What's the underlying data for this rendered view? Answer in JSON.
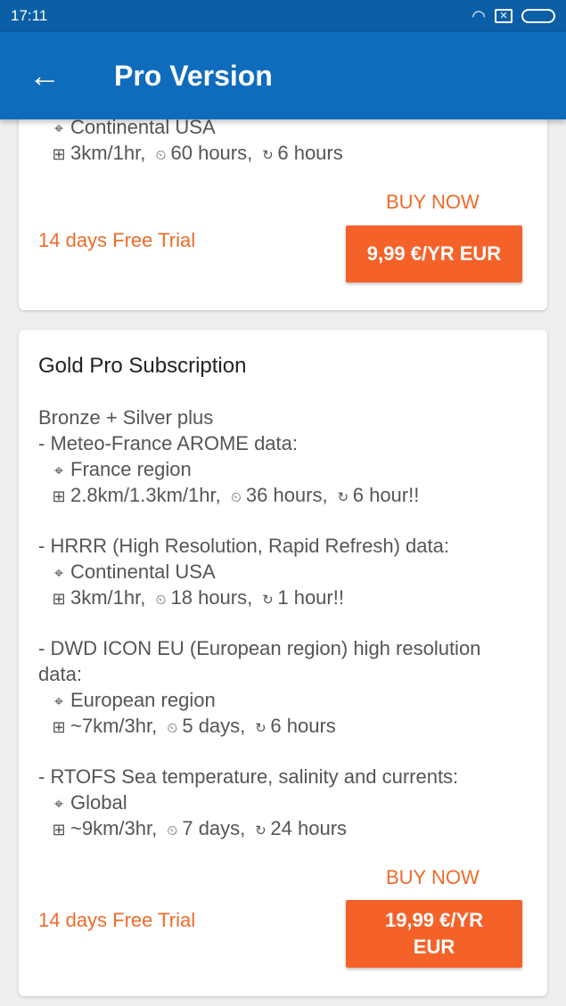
{
  "status_bar": {
    "time": "17:11",
    "icons": [
      "wifi-icon",
      "sim-icon",
      "battery-icon"
    ]
  },
  "app_bar": {
    "back_icon": "arrow-left-icon",
    "title": "Pro Version"
  },
  "card_silver": {
    "region_line": "Continental USA",
    "res_line": {
      "res": "3km/1hr,",
      "range": "60 hours,",
      "update": "6 hours"
    },
    "buy_now": "BUY NOW",
    "trial": "14 days Free Trial",
    "price": "9,99 €/YR EUR"
  },
  "card_gold": {
    "title": "Gold Pro Subscription",
    "intro": "Bronze + Silver plus",
    "sections": [
      {
        "heading": "- Meteo-France AROME data:",
        "region": "France region",
        "res": "2.8km/1.3km/1hr,",
        "range": "36 hours,",
        "update": "6 hour!!"
      },
      {
        "heading": "- HRRR (High Resolution, Rapid Refresh) data:",
        "region": "Continental USA",
        "res": "3km/1hr,",
        "range": "18 hours,",
        "update": "1 hour!!"
      },
      {
        "heading": "- DWD ICON EU (European region) high resolution",
        "heading2": "data:",
        "region": "European region",
        "res": "~7km/3hr,",
        "range": "5 days,",
        "update": "6 hours"
      },
      {
        "heading": "- RTOFS Sea temperature, salinity and currents:",
        "region": "Global",
        "res": "~9km/3hr,",
        "range": "7 days,",
        "update": "24 hours"
      }
    ],
    "buy_now": "BUY NOW",
    "trial": "14 days Free Trial",
    "price_line1": "19,99 €/YR",
    "price_line2": "EUR"
  },
  "colors": {
    "status_bar": "#0b5fa6",
    "app_bar": "#0f6cbd",
    "accent": "#f06a2a",
    "button": "#f4622a",
    "background": "#eeeeee"
  }
}
